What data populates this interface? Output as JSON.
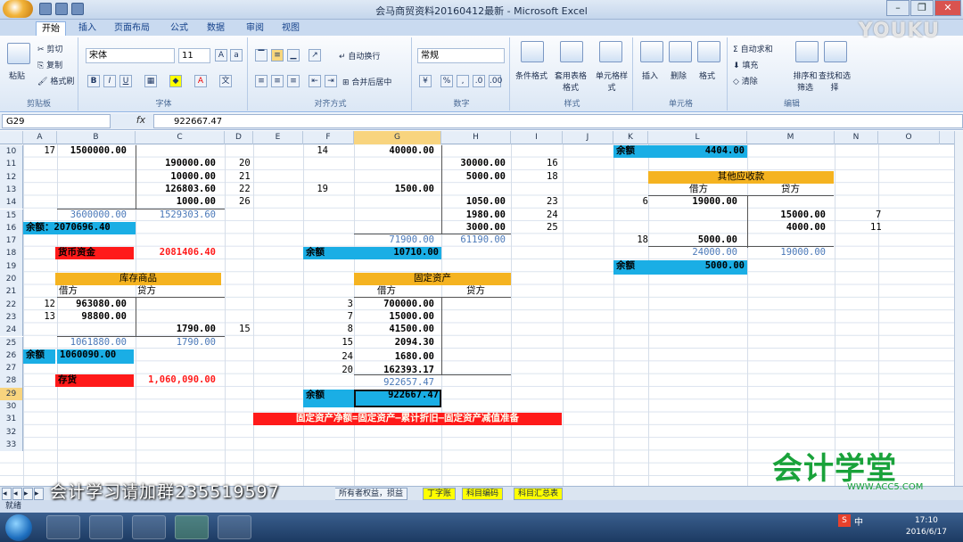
{
  "window": {
    "title": "会马商贸资料20160412最新 - Microsoft Excel"
  },
  "tabs": [
    "开始",
    "插入",
    "页面布局",
    "公式",
    "数据",
    "审阅",
    "视图"
  ],
  "ribbon": {
    "clipboard": {
      "paste": "粘贴",
      "cut": "剪切",
      "copy": "复制",
      "format_painter": "格式刷",
      "label": "剪贴板"
    },
    "font": {
      "name": "宋体",
      "size": "11",
      "label": "字体"
    },
    "align": {
      "wrap": "自动换行",
      "merge": "合并后居中",
      "label": "对齐方式"
    },
    "number": {
      "format": "常规",
      "label": "数字"
    },
    "styles": {
      "cond": "条件格式",
      "table": "套用表格格式",
      "cell": "单元格样式",
      "label": "样式"
    },
    "cells": {
      "insert": "插入",
      "delete": "删除",
      "format": "格式",
      "label": "单元格"
    },
    "editing": {
      "autosum": "自动求和",
      "fill": "填充",
      "clear": "清除",
      "sort": "排序和筛选",
      "find": "查找和选择",
      "label": "编辑"
    }
  },
  "formula_bar": {
    "name_box": "G29",
    "fx": "fx",
    "formula": "922667.47"
  },
  "columns": [
    "A",
    "B",
    "C",
    "D",
    "E",
    "F",
    "G",
    "H",
    "I",
    "J",
    "K",
    "L",
    "M",
    "N",
    "O"
  ],
  "selected_column": "G",
  "rows": [
    "10",
    "11",
    "12",
    "13",
    "14",
    "15",
    "16",
    "17",
    "18",
    "19",
    "20",
    "21",
    "22",
    "23",
    "24",
    "25",
    "26",
    "27",
    "28",
    "29",
    "30",
    "31",
    "32",
    "33"
  ],
  "selected_row": "29",
  "cells": {
    "a10": "17",
    "b10": "1500000.00",
    "c11": "190000.00",
    "d11": "20",
    "c12": "10000.00",
    "d12": "21",
    "c13": "126803.60",
    "d13": "22",
    "c14": "1000.00",
    "d14": "26",
    "b15": "3600000.00",
    "c15": "1529303.60",
    "a16": "余额：2070696.40",
    "b18_label": "货币资金",
    "c18": "2081406.40",
    "inv_title": "库存商品",
    "inv_debit": "借方",
    "inv_credit": "贷方",
    "a22": "12",
    "b22": "963080.00",
    "a23": "13",
    "b23": "98800.00",
    "c24": "1790.00",
    "d24": "15",
    "b25": "1061880.00",
    "c25": "1790.00",
    "a26": "余额",
    "b26": "1060090.00",
    "b28_label": "存货",
    "c28": "1,060,090.00",
    "f10": "14",
    "g10": "40000.00",
    "h11": "30000.00",
    "i11": "16",
    "h12": "5000.00",
    "i12": "18",
    "f13": "19",
    "g13": "1500.00",
    "h14": "1050.00",
    "i14": "23",
    "h15": "1980.00",
    "i15": "24",
    "h16": "3000.00",
    "i16": "25",
    "g17": "71900.00",
    "h17": "61190.00",
    "f18": "余额",
    "g18": "10710.00",
    "fa_title": "固定资产",
    "fa_debit": "借方",
    "fa_credit": "贷方",
    "f22": "3",
    "g22": "700000.00",
    "f23": "7",
    "g23": "15000.00",
    "f24": "8",
    "g24": "41500.00",
    "f25": "15",
    "g25": "2094.30",
    "f26": "24",
    "g26": "1680.00",
    "f27": "20",
    "g27": "162393.17",
    "g28": "922657.47",
    "f29": "余额",
    "g29": "922667.47",
    "red_banner": "固定资产净额=固定资产—累计折旧—固定资产减值准备",
    "k10": "余额",
    "l10": "4404.00",
    "oth_title": "其他应收款",
    "oth_debit": "借方",
    "oth_credit": "贷方",
    "k14": "6",
    "l14": "19000.00",
    "m15": "15000.00",
    "n15": "7",
    "m16": "4000.00",
    "n16": "11",
    "k17": "18",
    "l17": "5000.00",
    "l18": "24000.00",
    "m18": "19000.00",
    "k19": "余额",
    "l19": "5000.00"
  },
  "sheet_tabs": {
    "partial": "所有者权益，损益",
    "t1": "丁字账",
    "t2": "科目编码",
    "t3": "科目汇总表"
  },
  "status": "就绪",
  "overlay": {
    "group_text": "会计学习请加群235519597",
    "youku": "YOUKU",
    "logo": "会计学堂",
    "logo_url": "WWW.ACC5.COM"
  },
  "clock": {
    "time": "17:10",
    "date": "2016/6/17"
  },
  "tray": {
    "input": "中"
  }
}
